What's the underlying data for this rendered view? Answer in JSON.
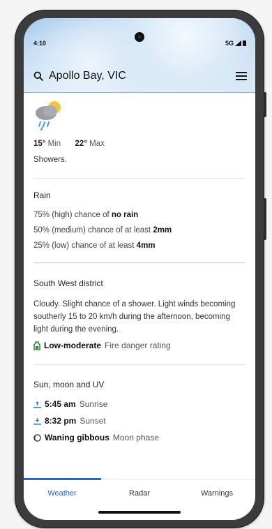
{
  "status": {
    "time": "4:10",
    "network": "5G"
  },
  "search": {
    "location": "Apollo Bay, VIC"
  },
  "forecast": {
    "min_value": "15°",
    "min_label": "Min",
    "max_value": "22°",
    "max_label": "Max",
    "summary": "Showers.",
    "icon": "showers-icon"
  },
  "rain": {
    "title": "Rain",
    "lines": [
      {
        "prefix": "75% (high) chance of ",
        "bold": "no rain"
      },
      {
        "prefix": "50% (medium) chance of at least ",
        "bold": "2mm"
      },
      {
        "prefix": "25% (low) chance of at least ",
        "bold": "4mm"
      }
    ]
  },
  "district": {
    "title": "South West district",
    "text": "Cloudy. Slight chance of a shower. Light winds becoming southerly 15 to 20 km/h during the afternoon, becoming light during the evening.",
    "fire_rating_value": "Low-moderate",
    "fire_rating_label": "Fire danger rating"
  },
  "astro": {
    "title": "Sun, moon and UV",
    "sunrise_time": "5:45 am",
    "sunrise_label": "Sunrise",
    "sunset_time": "8:32 pm",
    "sunset_label": "Sunset",
    "moon_phase_value": "Waning gibbous",
    "moon_phase_label": "Moon phase"
  },
  "tabs": [
    {
      "label": "Weather",
      "active": true
    },
    {
      "label": "Radar",
      "active": false
    },
    {
      "label": "Warnings",
      "active": false
    }
  ],
  "colors": {
    "accent": "#2b66c4",
    "fire_low": "#2e8b3e"
  }
}
